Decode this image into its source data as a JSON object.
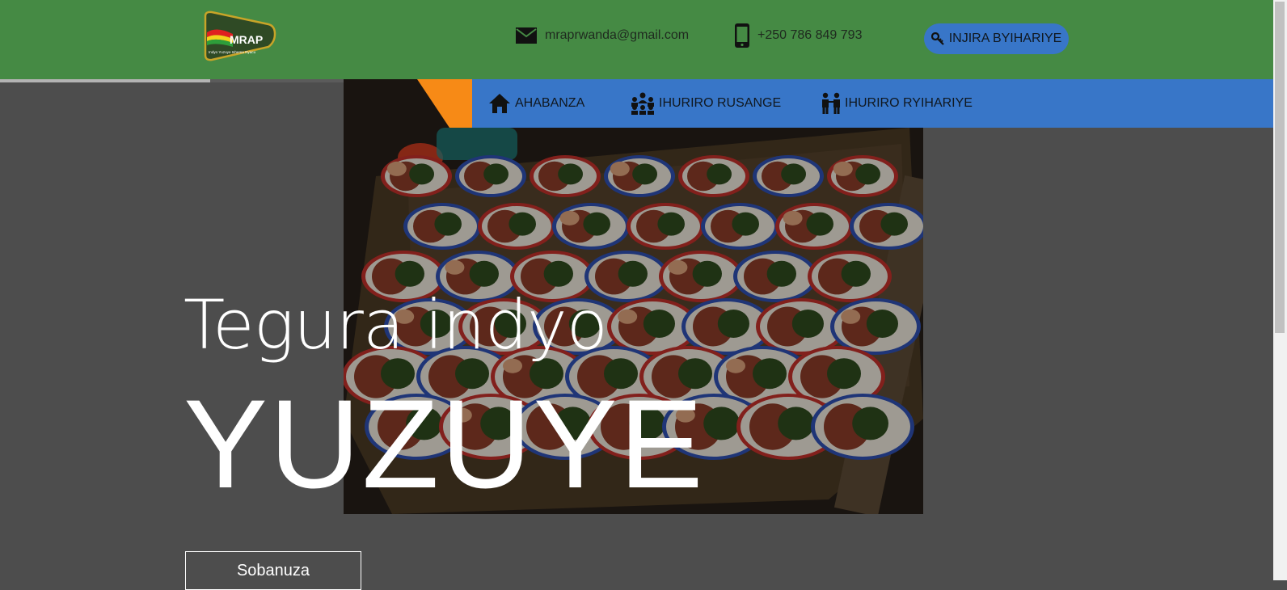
{
  "header": {
    "logo_text": "MRAP",
    "logo_tagline": "Indyo Yuzuye Ishema Ryacu",
    "email": "mraprwanda@gmail.com",
    "phone": "+250 786 849 793",
    "login_label": "INJIRA BYIHARIYE"
  },
  "nav": {
    "items": [
      {
        "label": "AHABANZA",
        "icon": "home-icon"
      },
      {
        "label": "IHURIRO RUSANGE",
        "icon": "group-icon"
      },
      {
        "label": "IHURIRO RYIHARIYE",
        "icon": "couple-icon"
      }
    ]
  },
  "hero": {
    "subtitle": "Tegura indyo",
    "title": "YUZUYE",
    "button_label": "Sobanuza"
  },
  "progress": {
    "fraction": 0.165
  },
  "colors": {
    "header_bg": "#458a44",
    "nav_bg": "#3876c8",
    "accent_orange": "#f78a16",
    "page_bg": "#4d4d4d"
  }
}
